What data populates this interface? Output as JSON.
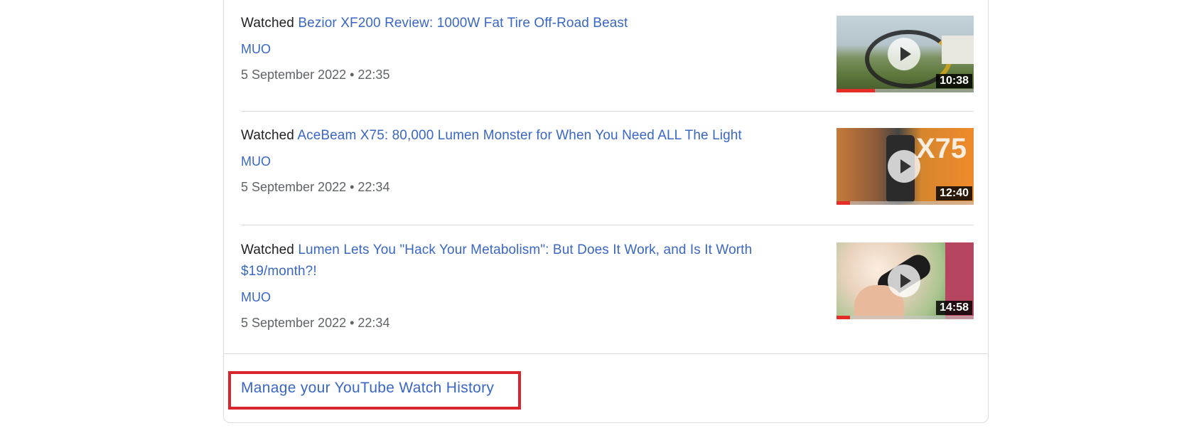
{
  "history": {
    "entries": [
      {
        "prefix": "Watched",
        "title": "Bezior XF200 Review: 1000W Fat Tire Off-Road Beast",
        "channel": "MUO",
        "timestamp": "5 September 2022 • 22:35",
        "duration": "10:38",
        "progress": 0.28,
        "thumb_colors": [
          "#b8c7cf",
          "#6f8a5c",
          "#3f5a2a"
        ]
      },
      {
        "prefix": "Watched",
        "title": "AceBeam X75: 80,000 Lumen Monster for When You Need ALL The Light",
        "channel": "MUO",
        "timestamp": "5 September 2022 • 22:34",
        "duration": "12:40",
        "progress": 0.1,
        "thumb_colors": [
          "#f08a2a",
          "#3a3a3a",
          "#c9b79a"
        ]
      },
      {
        "prefix": "Watched",
        "title": "Lumen Lets You \"Hack Your Metabolism\": But Does It Work, and Is It Worth $19/month?!",
        "channel": "MUO",
        "timestamp": "5 September 2022 • 22:34",
        "duration": "14:58",
        "progress": 0.1,
        "thumb_colors": [
          "#f3e2d2",
          "#8fb97a",
          "#d27b92"
        ]
      }
    ]
  },
  "footer": {
    "manage_label": "Manage your YouTube Watch History"
  },
  "colors": {
    "link": "#3a67c4",
    "highlight_box": "#d9262e",
    "progress": "#e52d27"
  }
}
